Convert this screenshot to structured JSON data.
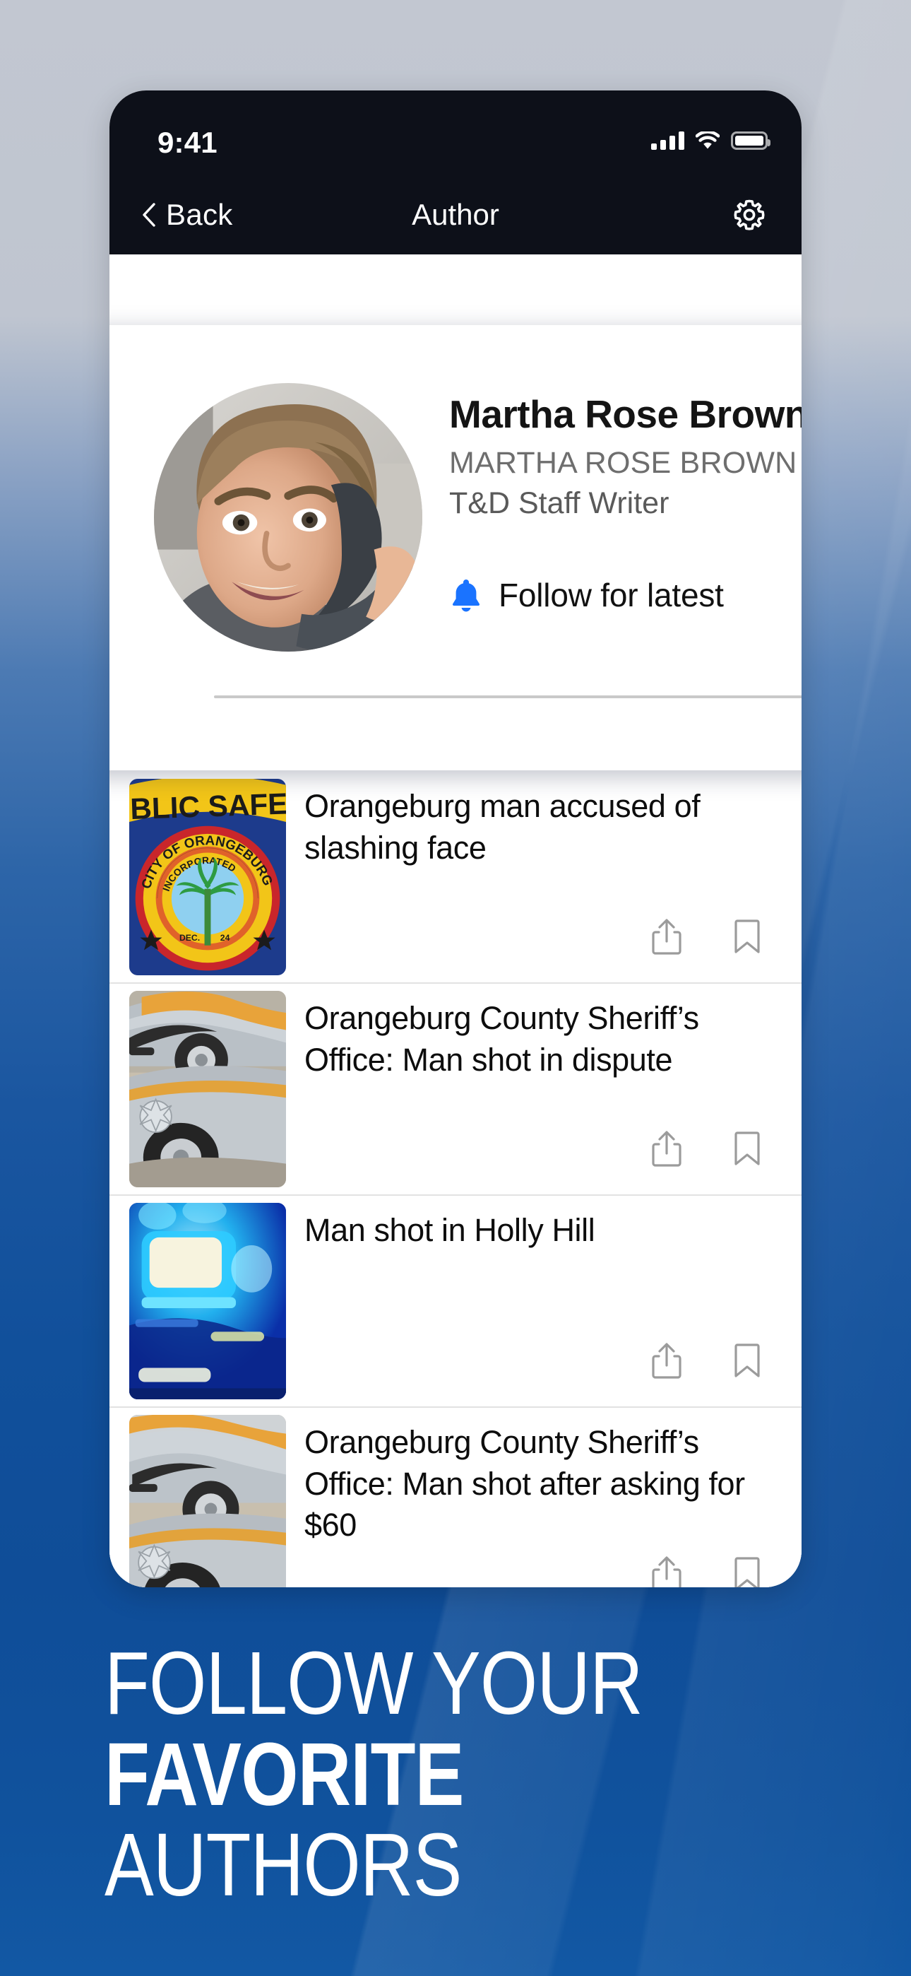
{
  "theme": {
    "accent_blue": "#1a73ff",
    "bg_blue": "#0f4d98",
    "statusbar_bg": "#0d1019",
    "card_bg": "#ffffff"
  },
  "statusbar": {
    "time": "9:41",
    "cellular_icon": "cellular-bars-icon",
    "wifi_icon": "wifi-icon",
    "battery_icon": "battery-full-icon"
  },
  "navbar": {
    "back_label": "Back",
    "back_icon": "chevron-left-icon",
    "title": "Author",
    "settings_icon": "gear-icon"
  },
  "author_card": {
    "avatar_alt": "author-photo",
    "name": "Martha Rose Brown",
    "byline": "MARTHA ROSE BROWN",
    "role": "T&D Staff Writer",
    "follow_label": "Follow for latest",
    "follow_icon": "bell-icon"
  },
  "articles": [
    {
      "title": "Orangeburg man accused of slashing face",
      "thumb": "orangeburg-public-safety-seal",
      "share_icon": "share-icon",
      "bookmark_icon": "bookmark-icon"
    },
    {
      "title": "Orangeburg County Sheriff’s Office: Man shot in dispute",
      "thumb": "sheriff-patrol-car",
      "share_icon": "share-icon",
      "bookmark_icon": "bookmark-icon"
    },
    {
      "title": "Man shot in Holly Hill",
      "thumb": "police-blue-lights",
      "share_icon": "share-icon",
      "bookmark_icon": "bookmark-icon"
    },
    {
      "title": "Orangeburg County Sheriff’s Office: Man shot after asking for $60",
      "thumb": "sheriff-patrol-car",
      "share_icon": "share-icon",
      "bookmark_icon": "bookmark-icon"
    }
  ],
  "caption": {
    "line1": "FOLLOW YOUR",
    "line2": "FAVORITE",
    "line3": "AUTHORS"
  }
}
